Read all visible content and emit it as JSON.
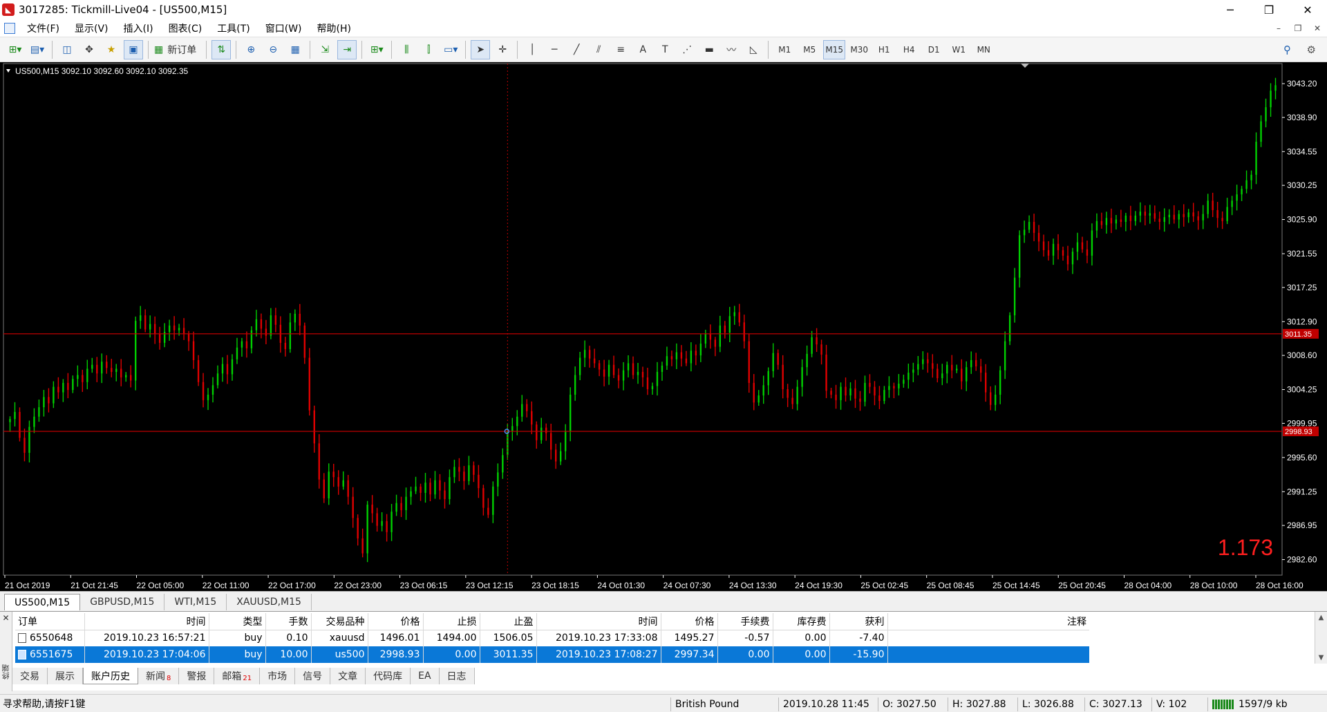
{
  "window": {
    "title": "3017285: Tickmill-Live04 - [US500,M15]",
    "controls": [
      "─",
      "❐",
      "✕"
    ]
  },
  "menu": {
    "items": [
      "文件(F)",
      "显示(V)",
      "插入(I)",
      "图表(C)",
      "工具(T)",
      "窗口(W)",
      "帮助(H)"
    ],
    "mdi_controls": [
      "–",
      "❐",
      "✕"
    ]
  },
  "toolbar": {
    "new_order_label": "新订单",
    "timeframes": [
      "M1",
      "M5",
      "M15",
      "M30",
      "H1",
      "H4",
      "D1",
      "W1",
      "MN"
    ],
    "active_timeframe": "M15"
  },
  "chart": {
    "info": "US500,M15  3092.10 3092.60 3092.10 3092.35",
    "big_value": "1.173",
    "price_levels": [
      "3043.20",
      "3038.90",
      "3034.55",
      "3030.25",
      "3025.90",
      "3021.55",
      "3017.25",
      "3012.90",
      "3008.60",
      "3004.25",
      "2999.95",
      "2995.60",
      "2991.25",
      "2986.95",
      "2982.60"
    ],
    "hline_labels": [
      "3011.35",
      "2998.93"
    ],
    "time_labels": [
      "21 Oct 2019",
      "21 Oct 21:45",
      "22 Oct 05:00",
      "22 Oct 11:00",
      "22 Oct 17:00",
      "22 Oct 23:00",
      "23 Oct 06:15",
      "23 Oct 12:15",
      "23 Oct 18:15",
      "24 Oct 01:30",
      "24 Oct 07:30",
      "24 Oct 13:30",
      "24 Oct 19:30",
      "25 Oct 02:45",
      "25 Oct 08:45",
      "25 Oct 14:45",
      "25 Oct 20:45",
      "28 Oct 04:00",
      "28 Oct 10:00",
      "28 Oct 16:00"
    ],
    "colors": {
      "bull": "#00d000",
      "bear": "#e00000",
      "background": "#000000",
      "axis_text": "#ffffff",
      "hline": "#c00000"
    },
    "series_closes": [
      3000.5,
      3001.4,
      2998.1,
      2996.2,
      2999.5,
      3000.8,
      3002.0,
      3003.3,
      3002.5,
      3004.6,
      3003.9,
      3005.1,
      3004.2,
      3005.6,
      3006.1,
      3005.2,
      3006.9,
      3007.4,
      3006.3,
      3007.8,
      3007.0,
      3006.5,
      3006.9,
      3005.8,
      3006.1,
      3005.4,
      3013.0,
      3013.7,
      3011.9,
      3012.6,
      3011.3,
      3010.2,
      3011.6,
      3012.4,
      3011.8,
      3012.1,
      3011.3,
      3010.4,
      3008.0,
      3005.2,
      3002.9,
      3003.6,
      3004.8,
      3006.3,
      3007.5,
      3006.2,
      3008.1,
      3009.6,
      3010.4,
      3009.5,
      3011.8,
      3013.2,
      3012.0,
      3011.1,
      3013.7,
      3012.5,
      3010.2,
      3009.4,
      3012.8,
      3013.9,
      3012.4,
      3008.3,
      3001.6,
      2997.4,
      2992.8,
      2990.4,
      2993.8,
      2993.1,
      2991.9,
      2992.7,
      2990.6,
      2987.9,
      2985.3,
      2983.4,
      2989.6,
      2988.5,
      2986.9,
      2987.5,
      2986.1,
      2988.7,
      2989.8,
      2988.9,
      2990.6,
      2991.3,
      2991.9,
      2991.1,
      2992.4,
      2990.9,
      2992.7,
      2991.4,
      2990.3,
      2993.1,
      2994.4,
      2993.8,
      2992.6,
      2994.6,
      2993.4,
      2991.7,
      2989.2,
      2988.3,
      2991.9,
      2993.7,
      2995.9,
      2998.9,
      2999.6,
      3000.8,
      3002.4,
      3001.5,
      2999.8,
      2997.8,
      2999.4,
      2998.7,
      2996.6,
      2995.1,
      2996.4,
      2998.9,
      3003.6,
      3006.1,
      3008.3,
      3009.3,
      3008.2,
      3007.6,
      3006.8,
      3005.9,
      3007.4,
      3006.1,
      3005.4,
      3006.7,
      3007.6,
      3006.1,
      3006.5,
      3005.8,
      3004.3,
      3004.7,
      3006.5,
      3007.3,
      3008.5,
      3008.1,
      3009.0,
      3008.2,
      3007.6,
      3009.2,
      3008.6,
      3010.1,
      3011.3,
      3010.6,
      3009.7,
      3012.4,
      3011.5,
      3013.6,
      3014.1,
      3012.8,
      3010.4,
      3005.1,
      3002.6,
      3003.5,
      3004.8,
      3006.6,
      3008.9,
      3007.4,
      3004.3,
      3003.2,
      3002.4,
      3004.6,
      3007.1,
      3008.8,
      3010.9,
      3010.0,
      3008.7,
      3004.1,
      3003.6,
      3002.9,
      3004.6,
      3003.5,
      3004.4,
      3003.1,
      3002.7,
      3005.1,
      3004.6,
      3003.5,
      3002.8,
      3004.2,
      3004.7,
      3004.4,
      3005.0,
      3005.5,
      3006.4,
      3006.8,
      3007.5,
      3008.1,
      3007.6,
      3006.9,
      3005.7,
      3006.3,
      3007.4,
      3006.7,
      3006.9,
      3005.3,
      3007.1,
      3008.0,
      3007.2,
      3006.4,
      3003.9,
      3002.3,
      3003.6,
      3006.7,
      3010.4,
      3013.7,
      3018.5,
      3023.9,
      3024.6,
      3025.6,
      3024.2,
      3023.1,
      3022.0,
      3021.3,
      3022.8,
      3022.0,
      3021.3,
      3020.2,
      3021.8,
      3023.0,
      3022.1,
      3021.3,
      3024.5,
      3025.7,
      3025.2,
      3026.1,
      3025.4,
      3025.9,
      3025.6,
      3026.4,
      3025.7,
      3026.4,
      3026.9,
      3026.4,
      3026.7,
      3026.0,
      3025.6,
      3026.2,
      3026.5,
      3025.9,
      3026.6,
      3026.2,
      3026.8,
      3026.3,
      3025.8,
      3026.6,
      3028.3,
      3027.1,
      3026.1,
      3025.7,
      3027.5,
      3028.3,
      3029.1,
      3029.8,
      3030.9,
      3031.6,
      3035.8,
      3038.4,
      3040.2,
      3042.3,
      3043.0
    ]
  },
  "chart_tabs": [
    "US500,M15",
    "GBPUSD,M15",
    "WTI,M15",
    "XAUUSD,M15"
  ],
  "terminal": {
    "side_label": "终端",
    "columns": [
      "订单",
      "时间",
      "类型",
      "手数",
      "交易品种",
      "价格",
      "止损",
      "止盈",
      "时间",
      "价格",
      "手续费",
      "库存费",
      "获利",
      "注释"
    ],
    "rows": [
      [
        "6550648",
        "2019.10.23 16:57:21",
        "buy",
        "0.10",
        "xauusd",
        "1496.01",
        "1494.00",
        "1506.05",
        "2019.10.23 17:33:08",
        "1495.27",
        "-0.57",
        "0.00",
        "-7.40",
        ""
      ],
      [
        "6551675",
        "2019.10.23 17:04:06",
        "buy",
        "10.00",
        "us500",
        "2998.93",
        "0.00",
        "3011.35",
        "2019.10.23 17:08:27",
        "2997.34",
        "0.00",
        "0.00",
        "-15.90",
        ""
      ]
    ],
    "tabs": [
      {
        "label": "交易",
        "badge": ""
      },
      {
        "label": "展示",
        "badge": ""
      },
      {
        "label": "账户历史",
        "badge": ""
      },
      {
        "label": "新闻",
        "badge": "8"
      },
      {
        "label": "警报",
        "badge": ""
      },
      {
        "label": "邮箱",
        "badge": "21"
      },
      {
        "label": "市场",
        "badge": ""
      },
      {
        "label": "信号",
        "badge": ""
      },
      {
        "label": "文章",
        "badge": ""
      },
      {
        "label": "代码库",
        "badge": ""
      },
      {
        "label": "EA",
        "badge": ""
      },
      {
        "label": "日志",
        "badge": ""
      }
    ]
  },
  "status": {
    "help": "寻求帮助,请按F1键",
    "profile": "British Pound",
    "datetime": "2019.10.28 11:45",
    "open": "O: 3027.50",
    "high": "H: 3027.88",
    "low": "L: 3026.88",
    "close": "C: 3027.13",
    "volume": "V: 102",
    "traffic": "1597/9 kb"
  }
}
